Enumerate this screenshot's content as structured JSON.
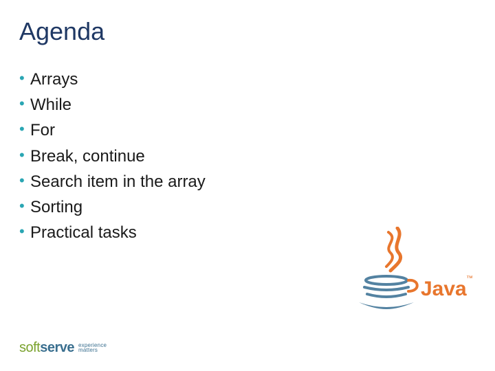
{
  "title": "Agenda",
  "bullets": [
    "Arrays",
    "While",
    "For",
    "Break, continue",
    "Search item in the array",
    "Sorting",
    "Practical tasks"
  ],
  "logo": {
    "part1": "soft",
    "part2": "serve",
    "tagline1": "experience",
    "tagline2": "matters"
  },
  "java_logo": {
    "name": "Java",
    "tm": "™"
  }
}
